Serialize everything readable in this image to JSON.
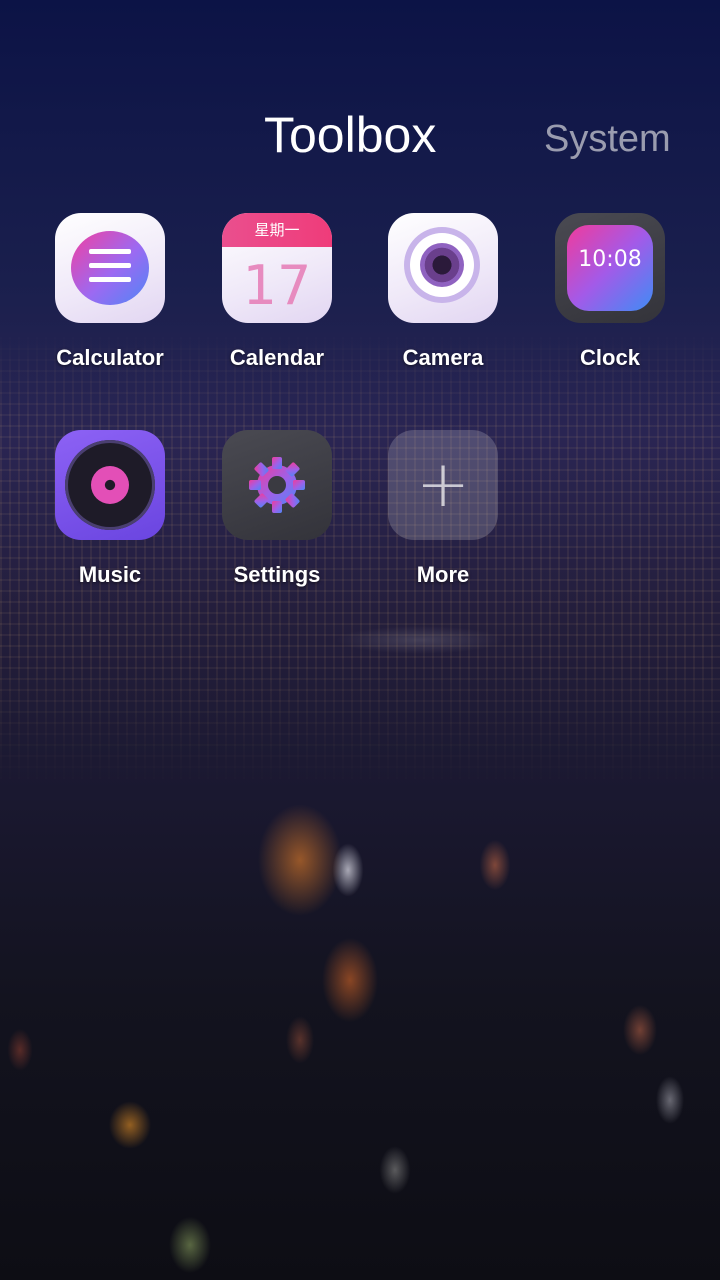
{
  "tabs": {
    "active": "Toolbox",
    "inactive": "System"
  },
  "apps": [
    {
      "label": "Calculator",
      "icon": "calculator-icon"
    },
    {
      "label": "Calendar",
      "icon": "calendar-icon",
      "weekday": "星期一",
      "day": "17"
    },
    {
      "label": "Camera",
      "icon": "camera-icon"
    },
    {
      "label": "Clock",
      "icon": "clock-icon",
      "time": "10:08"
    },
    {
      "label": "Music",
      "icon": "music-icon"
    },
    {
      "label": "Settings",
      "icon": "gear-icon"
    },
    {
      "label": "More",
      "icon": "plus-icon"
    }
  ],
  "colors": {
    "accent_pink": "#ef3c7a",
    "accent_purple": "#8d62f5",
    "accent_blue": "#4f86f5"
  }
}
